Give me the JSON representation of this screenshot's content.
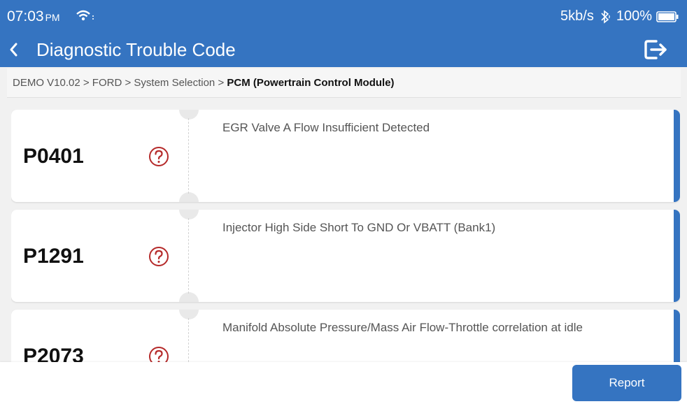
{
  "status_bar": {
    "time": "07:03",
    "ampm": "PM",
    "net_speed": "5kb/s",
    "battery": "100%",
    "icons": [
      "wifi-icon",
      "bluetooth-icon",
      "battery-icon"
    ]
  },
  "header": {
    "title": "Diagnostic Trouble Code",
    "back_icon": "chevron-left-icon",
    "exit_icon": "exit-icon"
  },
  "breadcrumb": {
    "path": "DEMO V10.02 > FORD > System Selection > ",
    "current": "PCM (Powertrain Control Module)"
  },
  "dtc_list": [
    {
      "code": "P0401",
      "description": "EGR Valve A Flow Insufficient Detected"
    },
    {
      "code": "P1291",
      "description": "Injector High Side Short To GND Or VBATT (Bank1)"
    },
    {
      "code": "P2073",
      "description": "Manifold Absolute Pressure/Mass Air Flow-Throttle correlation at idle"
    }
  ],
  "footer": {
    "report_label": "Report"
  },
  "colors": {
    "primary": "#3574c1",
    "help_icon": "#b52a2a"
  }
}
